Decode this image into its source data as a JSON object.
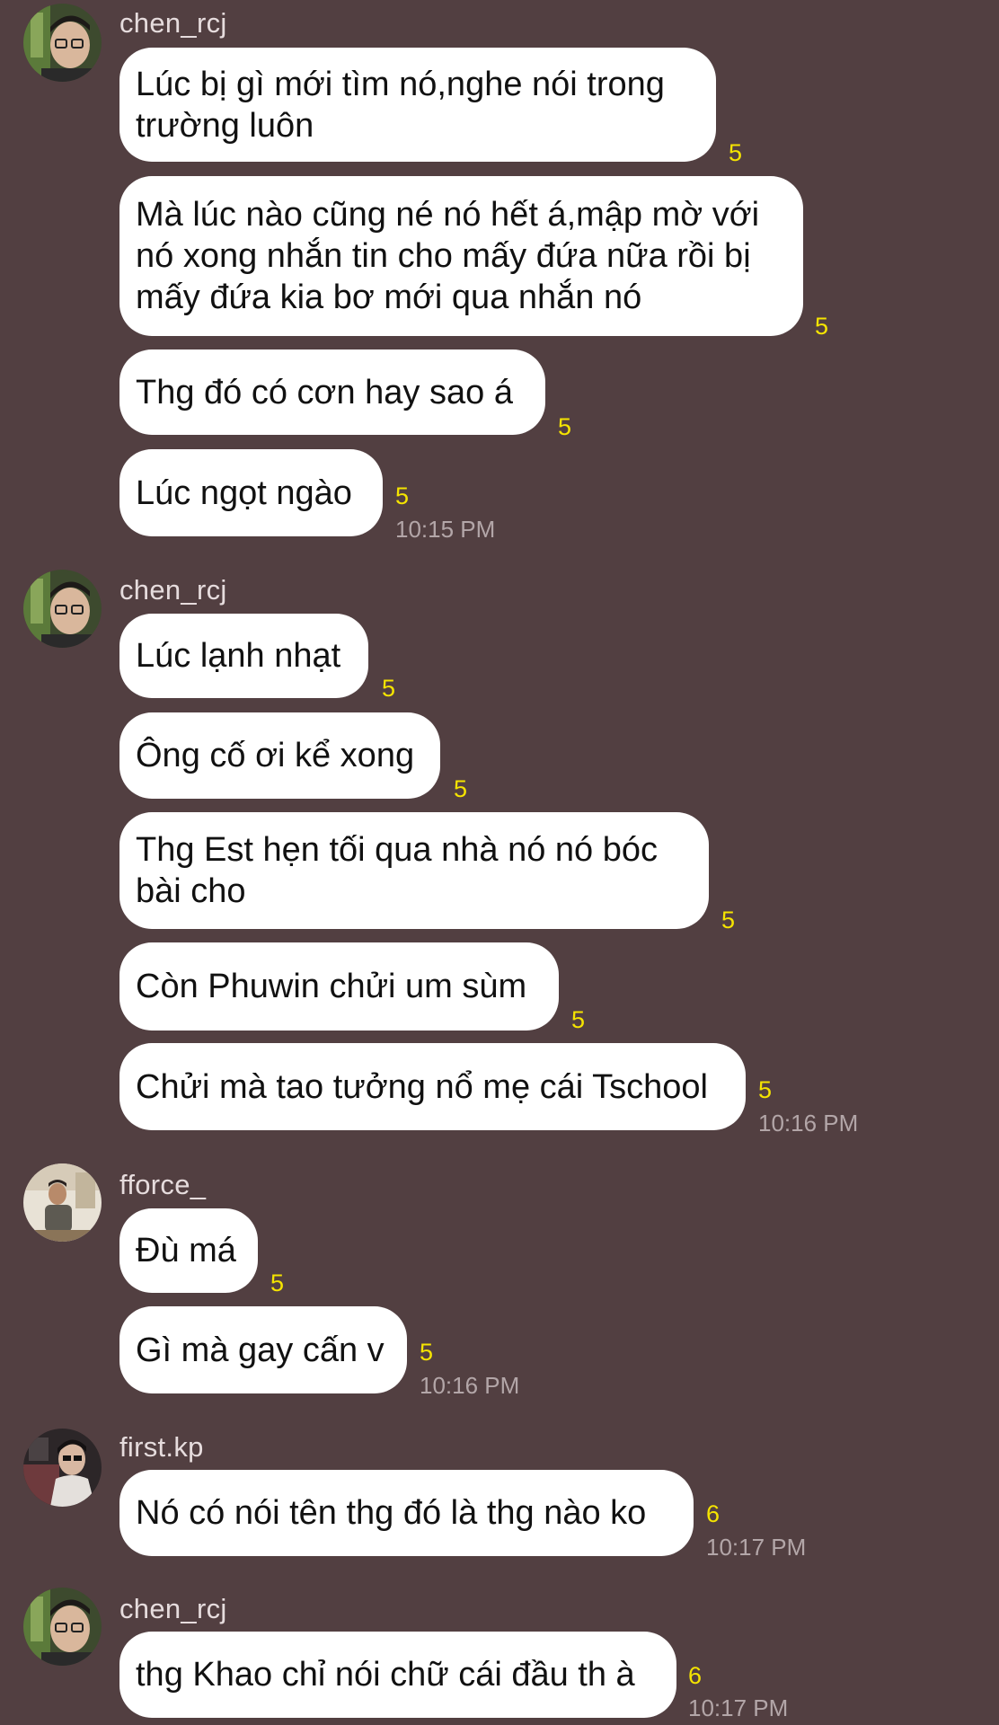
{
  "groups": [
    {
      "username": "chen_rcj",
      "avatar_icon": "avatar-chen-rcj-icon",
      "messages": [
        {
          "lines": [
            "Lúc bị gì mới tìm nó,nghe nói trong",
            "trường luôn"
          ],
          "read": "5"
        },
        {
          "lines": [
            "Mà lúc nào cũng né nó hết á,mập mờ với",
            "nó xong nhắn tin cho mấy đứa nữa rồi bị",
            "mấy đứa kia bơ mới qua nhắn nó"
          ],
          "read": "5"
        },
        {
          "lines": [
            "Thg đó có cơn hay sao á"
          ],
          "read": "5"
        },
        {
          "lines": [
            "Lúc ngọt ngào"
          ],
          "read": "5",
          "time": "10:15 PM"
        }
      ]
    },
    {
      "username": "chen_rcj",
      "avatar_icon": "avatar-chen-rcj-icon",
      "messages": [
        {
          "lines": [
            "Lúc lạnh nhạt"
          ],
          "read": "5"
        },
        {
          "lines": [
            "Ông cố ơi kể xong"
          ],
          "read": "5"
        },
        {
          "lines": [
            "Thg Est hẹn tối qua nhà nó nó bóc",
            "bài cho"
          ],
          "read": "5"
        },
        {
          "lines": [
            "Còn Phuwin chửi um sùm"
          ],
          "read": "5"
        },
        {
          "lines": [
            "Chửi mà tao tưởng nổ mẹ cái Tschool"
          ],
          "read": "5",
          "time": "10:16 PM"
        }
      ]
    },
    {
      "username": "fforce_",
      "avatar_icon": "avatar-fforce-icon",
      "messages": [
        {
          "lines": [
            "Đù má"
          ],
          "read": "5"
        },
        {
          "lines": [
            "Gì mà gay cấn v"
          ],
          "read": "5",
          "time": "10:16 PM"
        }
      ]
    },
    {
      "username": "first.kp",
      "avatar_icon": "avatar-first-kp-icon",
      "messages": [
        {
          "lines": [
            "Nó có nói tên thg đó là thg nào ko"
          ],
          "read": "6",
          "time": "10:17 PM"
        }
      ]
    },
    {
      "username": "chen_rcj",
      "avatar_icon": "avatar-chen-rcj-icon",
      "messages": [
        {
          "lines": [
            "thg Khao chỉ nói chữ cái đầu th à"
          ],
          "read": "6",
          "time": "10:17 PM"
        }
      ]
    }
  ],
  "colors": {
    "background": "#523f41",
    "bubble": "#ffffff",
    "read_count": "#f5e400",
    "timestamp": "#b3a6a8",
    "username": "#e6dcdd"
  }
}
